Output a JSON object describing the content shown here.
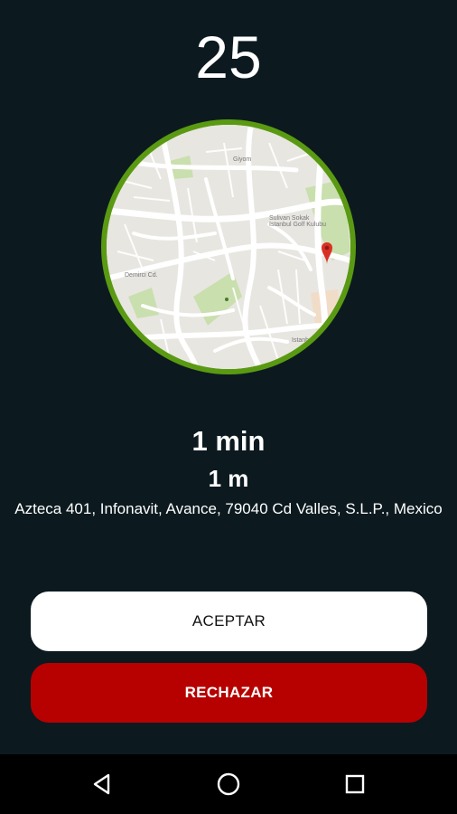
{
  "countdown": "25",
  "trip": {
    "time": "1 min",
    "distance": "1 m",
    "address": "Azteca 401, Infonavit, Avance, 79040 Cd Valles, S.L.P., Mexico"
  },
  "map": {
    "ring_color": "#5a9a12",
    "marker_icon": "map-pin-icon"
  },
  "buttons": {
    "accept_label": "ACEPTAR",
    "reject_label": "RECHAZAR",
    "reject_color": "#b70000"
  },
  "navbar": {
    "back_icon": "back-triangle-icon",
    "home_icon": "home-circle-icon",
    "recents_icon": "recents-square-icon"
  }
}
